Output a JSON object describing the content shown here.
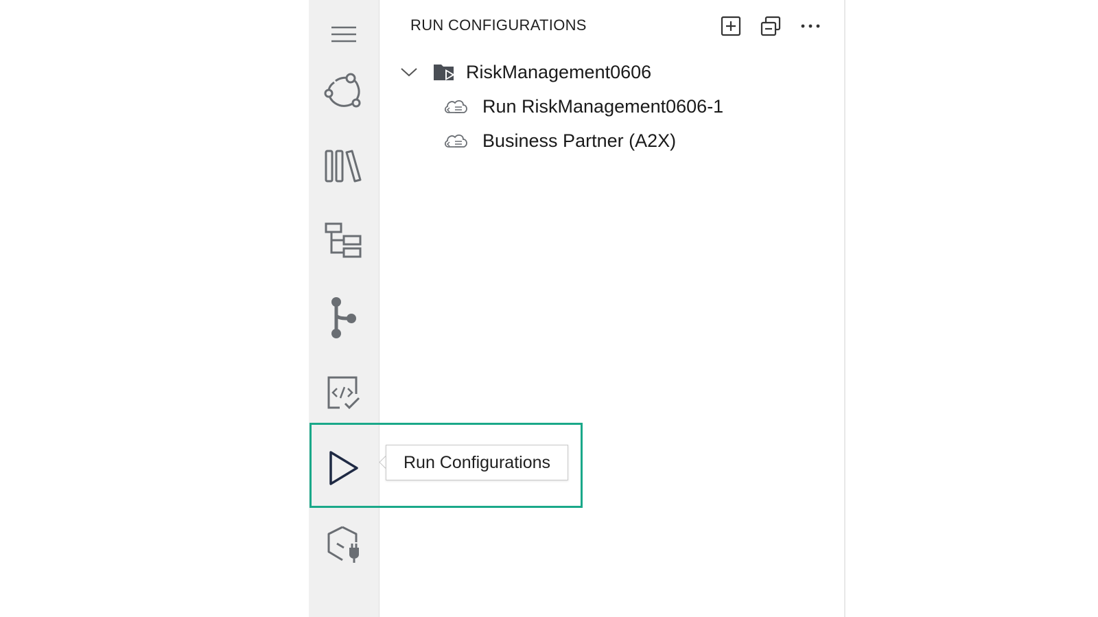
{
  "activity_bar": {
    "items": [
      {
        "name": "menu",
        "icon": "hamburger-menu-icon"
      },
      {
        "name": "explorer",
        "icon": "cycle-nodes-icon"
      },
      {
        "name": "library",
        "icon": "library-icon"
      },
      {
        "name": "outline",
        "icon": "hierarchy-tree-icon"
      },
      {
        "name": "source-control",
        "icon": "git-branch-icon"
      },
      {
        "name": "test",
        "icon": "code-check-icon"
      },
      {
        "name": "run-configurations",
        "icon": "play-icon",
        "active": true
      },
      {
        "name": "extensions",
        "icon": "cube-plug-icon"
      }
    ]
  },
  "panel": {
    "title": "RUN CONFIGURATIONS",
    "actions": [
      {
        "name": "new",
        "icon": "add-square-icon"
      },
      {
        "name": "collapse-all",
        "icon": "collapse-all-icon"
      },
      {
        "name": "more",
        "icon": "ellipsis-icon"
      }
    ],
    "tree": {
      "project": {
        "label": "RiskManagement0606",
        "expanded": true,
        "icon": "folder-run-icon"
      },
      "children": [
        {
          "label": "Run RiskManagement0606-1",
          "icon": "cloud-code-icon"
        },
        {
          "label": "Business Partner (A2X)",
          "icon": "cloud-code-icon"
        }
      ]
    }
  },
  "tooltip": {
    "text": "Run Configurations"
  },
  "colors": {
    "highlight": "#1aa889",
    "activity_bar_bg": "#f0f0f0",
    "icon": "#6a6e73",
    "active_icon": "#1f2a44"
  }
}
